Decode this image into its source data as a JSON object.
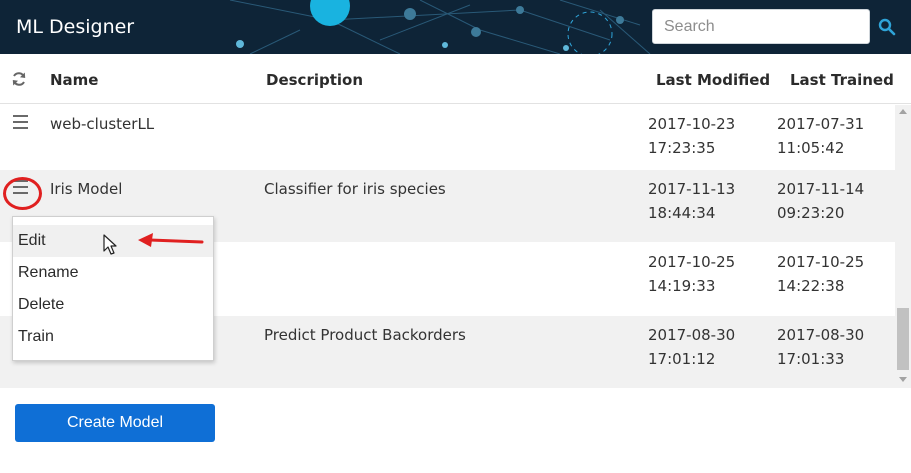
{
  "app": {
    "title": "ML Designer"
  },
  "search": {
    "placeholder": "Search",
    "icon": "search-icon"
  },
  "colors": {
    "header_bg": "#0e2437",
    "accent": "#0f6fd6",
    "highlight": "#e02020",
    "search_icon": "#2fa4d8"
  },
  "table": {
    "columns": {
      "name": "Name",
      "description": "Description",
      "last_modified": "Last Modified",
      "last_trained": "Last Trained"
    },
    "rows": [
      {
        "name": "web-clusterLL",
        "description": "",
        "modified_date": "2017-10-23",
        "modified_time": "17:23:35",
        "trained_date": "2017-07-31",
        "trained_time": "11:05:42"
      },
      {
        "name": "Iris Model",
        "description": "Classifier for iris species",
        "modified_date": "2017-11-13",
        "modified_time": "18:44:34",
        "trained_date": "2017-11-14",
        "trained_time": "09:23:20"
      },
      {
        "name": "",
        "description": "",
        "modified_date": "2017-10-25",
        "modified_time": "14:19:33",
        "trained_date": "2017-10-25",
        "trained_time": "14:22:38"
      },
      {
        "name": "",
        "description": "Predict Product Backorders",
        "modified_date": "2017-08-30",
        "modified_time": "17:01:12",
        "trained_date": "2017-08-30",
        "trained_time": "17:01:33"
      }
    ]
  },
  "context_menu": {
    "items": [
      "Edit",
      "Rename",
      "Delete",
      "Train"
    ],
    "hovered": "Edit"
  },
  "actions": {
    "create_label": "Create Model"
  }
}
